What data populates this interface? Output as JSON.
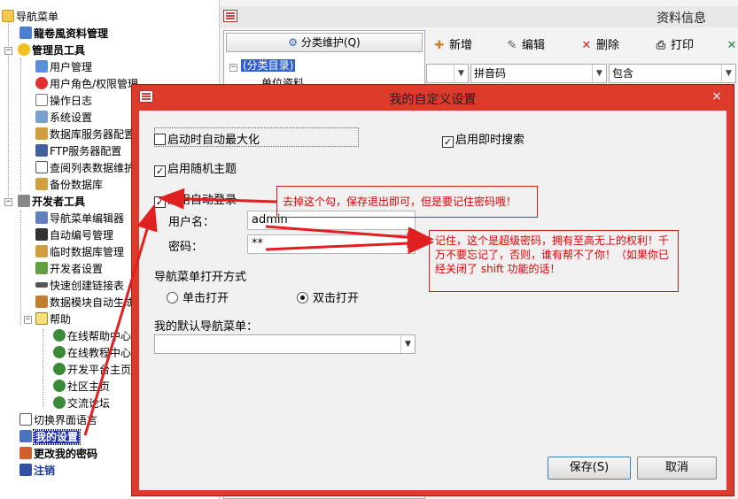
{
  "tree": {
    "root": "导航菜单",
    "items": [
      {
        "label": "龍卷風资料管理",
        "bold": true
      },
      {
        "label": "管理员工具",
        "bold": true
      },
      {
        "label": "用户管理"
      },
      {
        "label": "用户角色/权限管理"
      },
      {
        "label": "操作日志"
      },
      {
        "label": "系统设置"
      },
      {
        "label": "数据库服务器配置"
      },
      {
        "label": "FTP服务器配置"
      },
      {
        "label": "查阅列表数据维护"
      },
      {
        "label": "备份数据库"
      },
      {
        "label": "开发者工具",
        "bold": true
      },
      {
        "label": "导航菜单编辑器"
      },
      {
        "label": "自动编号管理"
      },
      {
        "label": "临时数据库管理"
      },
      {
        "label": "开发者设置"
      },
      {
        "label": "快速创建链接表"
      },
      {
        "label": "数据模块自动生成"
      },
      {
        "label": "帮助"
      },
      {
        "label": "在线帮助中心"
      },
      {
        "label": "在线教程中心"
      },
      {
        "label": "开发平台主页"
      },
      {
        "label": "社区主页"
      },
      {
        "label": "交流论坛"
      },
      {
        "label": "切换界面语言"
      },
      {
        "label": "我的设置",
        "bold": true,
        "selected": true
      },
      {
        "label": "更改我的密码",
        "bold": true
      },
      {
        "label": "注销",
        "bold": true
      }
    ]
  },
  "background": {
    "title": "资料信息",
    "category_button": "分类维护(Q)",
    "category_root": "(分类目录)",
    "category_child": "单位资料",
    "toolbar": {
      "add": "新增",
      "edit": "编辑",
      "delete": "删除",
      "print": "打印"
    },
    "search_field": "拼音码",
    "search_op": "包含"
  },
  "dialog": {
    "title": "我的自定义设置",
    "close_glyph": "×",
    "maximize_on_start": {
      "label": "启动时自动最大化",
      "checked": false
    },
    "instant_search": {
      "label": "启用即时搜索",
      "checked": true
    },
    "random_theme": {
      "label": "启用随机主题",
      "checked": true
    },
    "auto_login": {
      "label": "启用自动登录",
      "checked": true
    },
    "username_label": "用户名：",
    "username_value": "admin",
    "password_label": "密码：",
    "password_value": "**",
    "open_mode_label": "导航菜单打开方式",
    "single_click": "单击打开",
    "double_click": "双击打开",
    "open_mode_selected": "双击打开",
    "default_menu_label": "我的默认导航菜单：",
    "default_menu_value": "",
    "save_button": "保存(S)",
    "cancel_button": "取消"
  },
  "annotations": {
    "note1": "去掉这个勾，保存退出即可，但是要记住密码哦！",
    "note2": "记住，这个是超级密码，拥有至高无上的权利！千万不要忘记了，否则，谁有帮不了你！（如果你已经关闭了 shift 功能的话！"
  },
  "colors": {
    "dialog_frame": "#dc3a2a",
    "annotation": "#e00000",
    "selection": "#1d2fbf"
  }
}
